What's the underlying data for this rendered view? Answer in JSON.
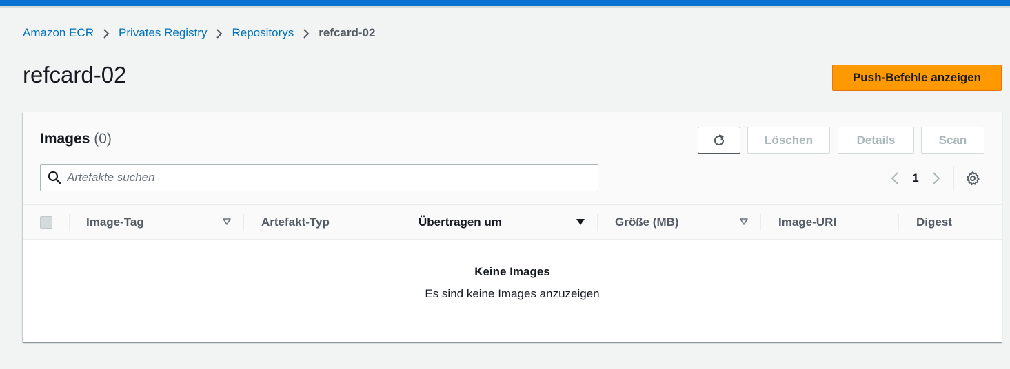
{
  "breadcrumb": {
    "items": [
      "Amazon ECR",
      "Privates Registry",
      "Repositorys"
    ],
    "current": "refcard-02"
  },
  "page": {
    "title": "refcard-02",
    "push_button": "Push-Befehle anzeigen"
  },
  "panel": {
    "title": "Images",
    "count": "(0)",
    "buttons": {
      "refresh_icon": "refresh-icon",
      "delete": "Löschen",
      "details": "Details",
      "scan": "Scan"
    },
    "search": {
      "placeholder": "Artefakte suchen",
      "value": ""
    },
    "pagination": {
      "current_page": "1"
    }
  },
  "table": {
    "columns": [
      "Image-Tag",
      "Artefakt-Typ",
      "Übertragen um",
      "Größe (MB)",
      "Image-URI",
      "Digest"
    ],
    "sorted_column": "Übertragen um",
    "rows": []
  },
  "empty_state": {
    "title": "Keine Images",
    "text": "Es sind keine Images anzuzeigen"
  },
  "colors": {
    "accent_blue": "#0972d3",
    "link": "#0073bb",
    "primary_button": "#ff9900",
    "background": "#f2f3f3"
  }
}
